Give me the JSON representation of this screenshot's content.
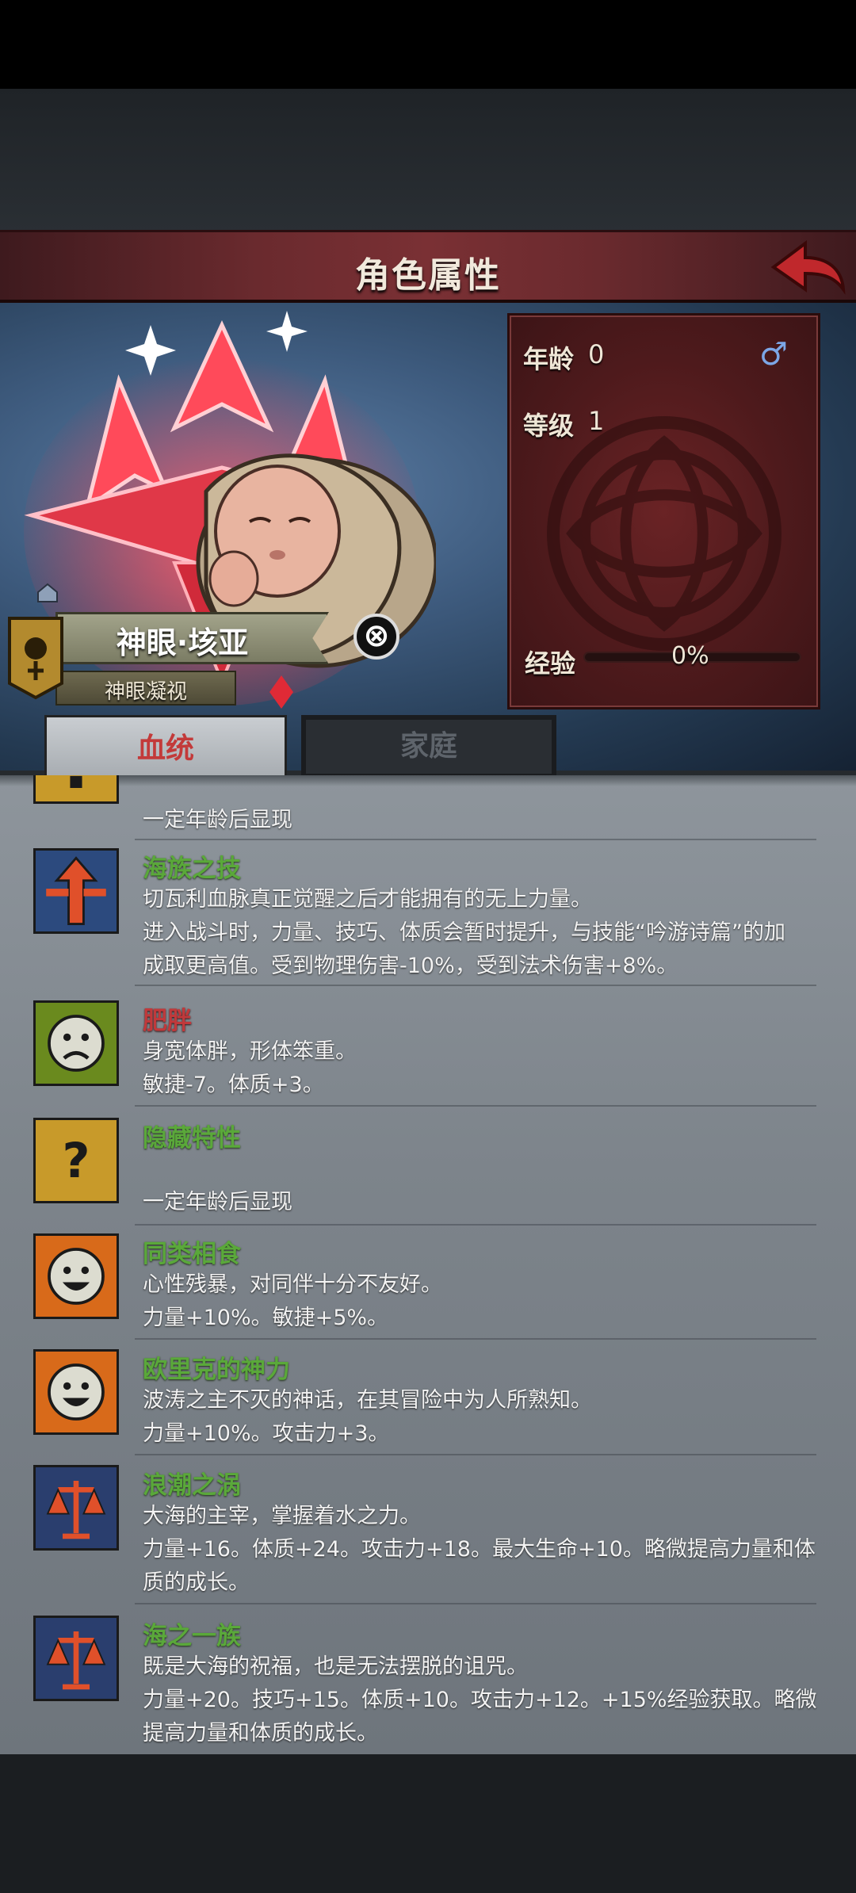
{
  "header": {
    "title": "角色属性"
  },
  "stats": {
    "age_label": "年龄",
    "age_value": "0",
    "level_label": "等级",
    "level_value": "1",
    "xp_label": "经验",
    "xp_value": "0%",
    "xp_progress": 0,
    "gender_icon": "male-icon",
    "gender_glyph": "♂"
  },
  "character": {
    "name": "神眼·垓亚",
    "title": "神眼凝视",
    "close_glyph": "⊗"
  },
  "tabs": [
    {
      "label": "血统",
      "active": true
    },
    {
      "label": "家庭",
      "active": false
    }
  ],
  "traits": [
    {
      "icon": "question-icon",
      "name": "",
      "name_color": "green",
      "lines": [
        "一定年龄后显现"
      ]
    },
    {
      "icon": "sea-skill-icon",
      "name": "海族之技",
      "name_color": "green",
      "lines": [
        "切瓦利血脉真正觉醒之后才能拥有的无上力量。",
        "进入战斗时，力量、技巧、体质会暂时提升，与技能“吟游诗篇”的加",
        "成取更高值。受到物理伤害-10%，受到法术伤害+8%。"
      ]
    },
    {
      "icon": "sad-face-icon",
      "name": "肥胖",
      "name_color": "red",
      "lines": [
        "身宽体胖，形体笨重。",
        "敏捷-7。体质+3。"
      ]
    },
    {
      "icon": "question-icon",
      "name": "隐藏特性",
      "name_color": "green",
      "lines": [
        "",
        "一定年龄后显现"
      ]
    },
    {
      "icon": "happy-face-icon",
      "name": "同类相食",
      "name_color": "green",
      "lines": [
        "心性残暴，对同伴十分不友好。",
        "力量+10%。敏捷+5%。"
      ]
    },
    {
      "icon": "happy-face-icon",
      "name": "欧里克的神力",
      "name_color": "green",
      "lines": [
        "波涛之主不灭的神话，在其冒险中为人所熟知。",
        "力量+10%。攻击力+3。"
      ]
    },
    {
      "icon": "scales-icon",
      "name": "浪潮之涡",
      "name_color": "green",
      "lines": [
        "大海的主宰，掌握着水之力。",
        "力量+16。体质+24。攻击力+18。最大生命+10。略微提高力量和体",
        "质的成长。"
      ]
    },
    {
      "icon": "scales-icon",
      "name": "海之一族",
      "name_color": "green",
      "lines": [
        "既是大海的祝福，也是无法摆脱的诅咒。",
        "力量+20。技巧+15。体质+10。攻击力+12。+15%经验获取。略微",
        "提高力量和体质的成长。"
      ]
    }
  ],
  "colors": {
    "accent_red": "#c0393b",
    "trait_green": "#5aa83a",
    "header_red": "#6a2a2e"
  }
}
